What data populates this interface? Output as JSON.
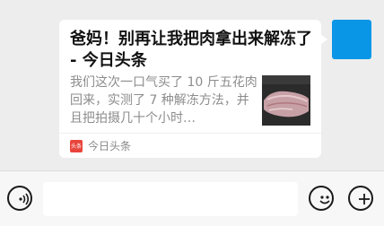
{
  "message": {
    "title": "爸妈！别再让我把肉拿出来解冻了 - 今日头条",
    "description": "我们这次一口气买了 10 斤五花肉回来，实测了 7 种解冻方法，并且把拍摄几十个小时…",
    "source_logo_text": "头条",
    "source_name": "今日头条",
    "thumbnail_icon": "pork-belly-thumbnail"
  },
  "avatar": {
    "color": "#0a96e6"
  },
  "input_bar": {
    "voice_icon": "voice-icon",
    "text_value": "",
    "emoji_icon": "emoji-icon",
    "plus_icon": "plus-icon"
  }
}
